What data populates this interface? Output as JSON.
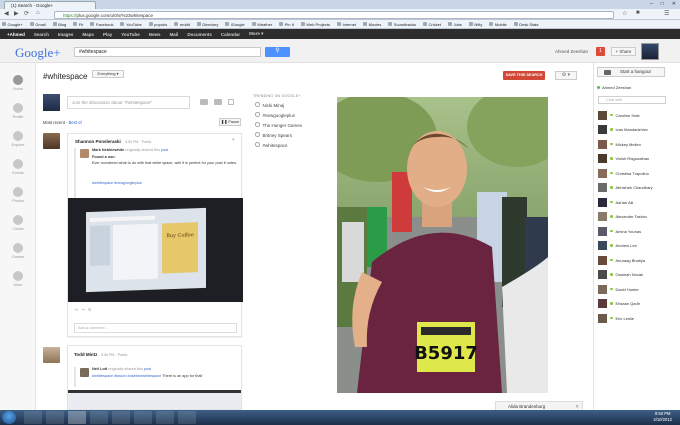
{
  "browser": {
    "tab_title": "(1) Search - Google+",
    "url_prefix": "https://",
    "url_rest": "plus.google.com/u/0/s/%23whitespace",
    "bookmarks": [
      "Google+",
      "Gmail",
      "Blog",
      "Fb",
      "Facebook",
      "YouTube",
      "popurls",
      "reddit",
      "Directory",
      "iGoogle",
      "Weather",
      "Pin It",
      "Web Projects",
      "Internet",
      "Movies",
      "Soundtracks",
      "Cricket",
      "Jobs",
      "Nifty",
      "Mobile",
      "Desk Stats"
    ]
  },
  "gbar": {
    "items": [
      "+Ahmed",
      "Search",
      "Images",
      "Maps",
      "Play",
      "YouTube",
      "News",
      "Mail",
      "Documents",
      "Calendar",
      "More ▾"
    ]
  },
  "header": {
    "logo": "Google+",
    "search_value": "#whitespace",
    "user_name": "Ahmed Zeeshan",
    "notifications": "1",
    "share_label": "+ Share"
  },
  "leftnav": [
    "Home",
    "Profile",
    "Explore",
    "Events",
    "Photos",
    "Circles",
    "Games",
    "More"
  ],
  "page": {
    "title": "#whitespace",
    "filter": "Everything ▾",
    "save_search": "SAVE THIS SEARCH",
    "gear": "⚙ ▾",
    "compose_placeholder": "Join the discussion about \"#whitespace\"",
    "most_recent": "Most recent",
    "best_of": "Best of",
    "pause": "❚❚ Pause"
  },
  "posts": [
    {
      "author": "Shannon Ponsleraski",
      "time": "4:50 PM",
      "visibility": "Public",
      "shared_from": "Mark Nebblewhite",
      "shared_text": "originally shared this",
      "shared_link": "post",
      "body_title": "Found a use:",
      "body_text": "Ever wondered what to do with that white space, well it is perfect for your post it notes.",
      "tags": "#whitespace #newgoogleplus",
      "plus": "+1",
      "comment_placeholder": "Add a comment..."
    },
    {
      "author": "Todd Mintz",
      "time": "5:56 PM",
      "visibility": "Public",
      "shared_from": "Neil Lott",
      "shared_text": "originally shared this",
      "shared_link": "post",
      "tags": "#whitespace #bacon #usesforwhitespace",
      "tail": "There is an app for that!"
    }
  ],
  "trending": {
    "title": "TRENDING ON GOOGLE+",
    "items": [
      "Nicki Minaj",
      "#newgoogleplus",
      "The Hunger Games",
      "Britney Spears",
      "#whitespace"
    ]
  },
  "photo": {
    "bib": "B5917"
  },
  "right": {
    "hangout": "Start a hangout",
    "chat_user": "Ahmed Zeeshan",
    "chat_search_placeholder": "Chat with",
    "contacts": [
      "Caroline Hale",
      "Ivan Mandadzhiev",
      "Mickey Mellen",
      "Vinish Ragunathan",
      "Christina Trapolino",
      "Abhishek Chaudhary",
      "Adrian Alii",
      "Alexander Tashov",
      "Amina Younas",
      "Andrew Lee",
      "Anuraag Bhatiya",
      "Osamah Novak",
      "David Hunter",
      "Ehsaan Qadir",
      "Eric Leslie"
    ]
  },
  "chat_popup": "Alida Brandenburg",
  "taskbar": {
    "time": "9:50 PM",
    "date": "4/10/2012"
  },
  "colors": {
    "google_blue": "#4272db",
    "save_red": "#d14836",
    "link": "#3366cc"
  }
}
